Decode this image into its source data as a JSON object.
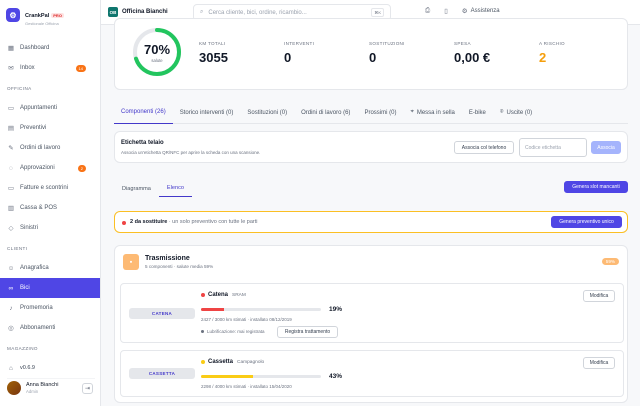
{
  "brand": {
    "logo": "⚙",
    "name": "CrankPal",
    "pro": "PRO",
    "sub": "Gestionale Officina"
  },
  "nav": {
    "dashboard": "Dashboard",
    "inbox": "Inbox",
    "inbox_badge": "14",
    "section_officina": "OFFICINA",
    "appuntamenti": "Appuntamenti",
    "preventivi": "Preventivi",
    "ordini": "Ordini di lavoro",
    "approvazioni": "Approvazioni",
    "approvazioni_badge": "2",
    "fatture": "Fatture e scontrini",
    "cassa": "Cassa & POS",
    "sinistri": "Sinistri",
    "section_clienti": "CLIENTI",
    "anagrafica": "Anagrafica",
    "bici": "Bici",
    "promemoria": "Promemoria",
    "abbonamenti": "Abbonamenti",
    "section_magazzino": "MAGAZZINO"
  },
  "version": "v0.6.9",
  "user": {
    "name": "Anna Bianchi",
    "role": "Admin"
  },
  "topbar": {
    "shop_logo": "OB",
    "shop_name": "Officina Bianchi",
    "search_placeholder": "Cerca cliente, bici, ordine, ricambio...",
    "search_kbd": "⌘K",
    "assist": "Assistenza"
  },
  "stats": {
    "health_value": "70%",
    "health_fraction": 0.7,
    "health_label": "salute",
    "km_label": "KM TOTALI",
    "km_value": "3055",
    "interventi_label": "INTERVENTI",
    "interventi_value": "0",
    "sostituzioni_label": "SOSTITUZIONI",
    "sostituzioni_value": "0",
    "spesa_label": "SPESA",
    "spesa_value": "0,00 €",
    "rischio_label": "A RISCHIO",
    "rischio_value": "2",
    "rischio_color": "#f59e0b",
    "gauge_color": "#22c55e"
  },
  "tabs": [
    "Componenti (26)",
    "Storico interventi (0)",
    "Sostituzioni (0)",
    "Ordini di lavoro (6)",
    "Prossimi (0)",
    "Messa in sella",
    "E-bike",
    "Uscite (0)"
  ],
  "etichetta": {
    "title": "Etichetta telaio",
    "sub": "Associa un'etichetta QR/NFC per aprire la scheda con una scansione.",
    "assoc_button": "Associa col telefono",
    "code_placeholder": "Codice etichetta",
    "assoc_disabled": "Associa"
  },
  "subtabs": [
    "Diagramma",
    "Elenco"
  ],
  "generate_slots": "Genera slot mancanti",
  "alert": {
    "bold": "2 da sostituire",
    "text": " · un solo preventivo con tutte le parti",
    "button": "Genera preventivo unico"
  },
  "group": {
    "title": "Trasmissione",
    "sub": "5 componenti · salute media 59%",
    "pill": "59%",
    "icon": "▪"
  },
  "components": [
    {
      "tag": "CATENA",
      "name": "Catena",
      "brand": "SRAM",
      "pct_label": "19%",
      "pct": 0.19,
      "color": "#ef4444",
      "meta": "2427 / 3000 km stimati · installato 08/12/2019",
      "lub": "Lubrificazione: mai registrata",
      "lub_button": "Registra trattamento",
      "edit": "Modifica"
    },
    {
      "tag": "CASSETTA",
      "name": "Cassetta",
      "brand": "Campagnolo",
      "pct_label": "43%",
      "pct": 0.43,
      "color": "#facc15",
      "meta": "2298 / 4000 km stimati · installato 15/04/2020",
      "edit": "Modifica"
    }
  ]
}
